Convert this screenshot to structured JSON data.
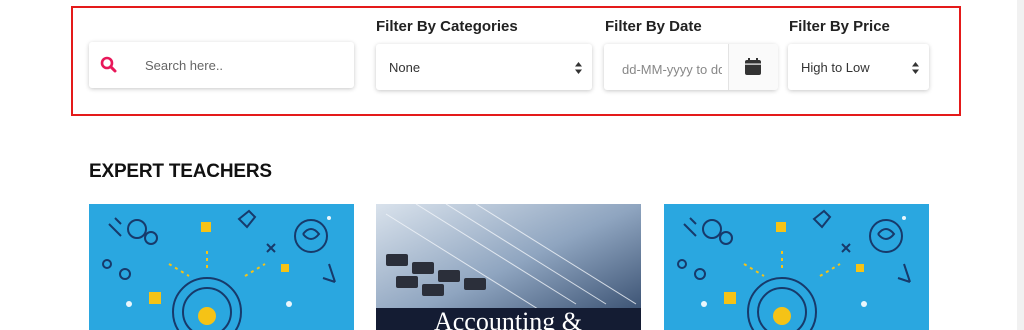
{
  "search": {
    "placeholder": "Search here.."
  },
  "filters": {
    "categories": {
      "label": "Filter By Categories",
      "value": "None"
    },
    "date": {
      "label": "Filter By Date",
      "placeholder": "dd-MM-yyyy to dd-MM-yyyy"
    },
    "price": {
      "label": "Filter By Price",
      "value": "High to Low"
    }
  },
  "section": {
    "title": "EXPERT TEACHERS"
  },
  "courses": [
    {
      "image": "science-icons-illustration"
    },
    {
      "image": "calculator-spreadsheet-photo",
      "visible_text": "Accounting &"
    },
    {
      "image": "science-icons-illustration"
    }
  ],
  "colors": {
    "accent": "#e8185a",
    "highlight_frame": "#e41a1a",
    "card_blue": "#2aa7e0"
  }
}
